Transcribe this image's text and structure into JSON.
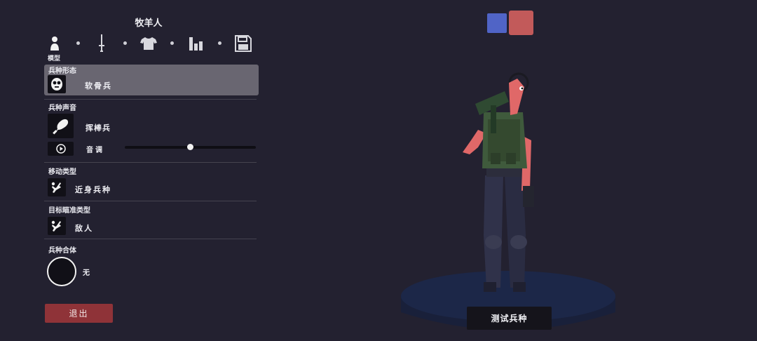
{
  "header": {
    "title": "牧羊人"
  },
  "tabs": [
    {
      "name": "model",
      "icon": "person-icon",
      "label": "模型",
      "active": true
    },
    {
      "name": "weapons",
      "icon": "sword-icon"
    },
    {
      "name": "clothing",
      "icon": "shirt-icon"
    },
    {
      "name": "stats",
      "icon": "bar-chart-icon"
    },
    {
      "name": "save",
      "icon": "save-icon"
    }
  ],
  "unit_form": {
    "label": "兵种形态",
    "value": "软骨兵",
    "icon": "ragdoll-face-icon"
  },
  "unit_voice": {
    "label": "兵种声音",
    "value": "挥棒兵",
    "icon": "club-icon",
    "pitch_label": "音调",
    "pitch_value": 0.5
  },
  "movement": {
    "label": "移动类型",
    "value": "近身兵种",
    "icon": "melee-icon"
  },
  "targeting": {
    "label": "目标瞄准类型",
    "value": "敌人",
    "icon": "target-enemy-icon"
  },
  "combine": {
    "label": "兵种合体",
    "value": "无"
  },
  "buttons": {
    "exit": "退出",
    "test": "测试兵种"
  },
  "team_colors": {
    "blue": "#5064c6",
    "red": "#c25a5a"
  },
  "colors": {
    "background": "#232130",
    "panel": "#696671",
    "exit": "#8f3338"
  }
}
